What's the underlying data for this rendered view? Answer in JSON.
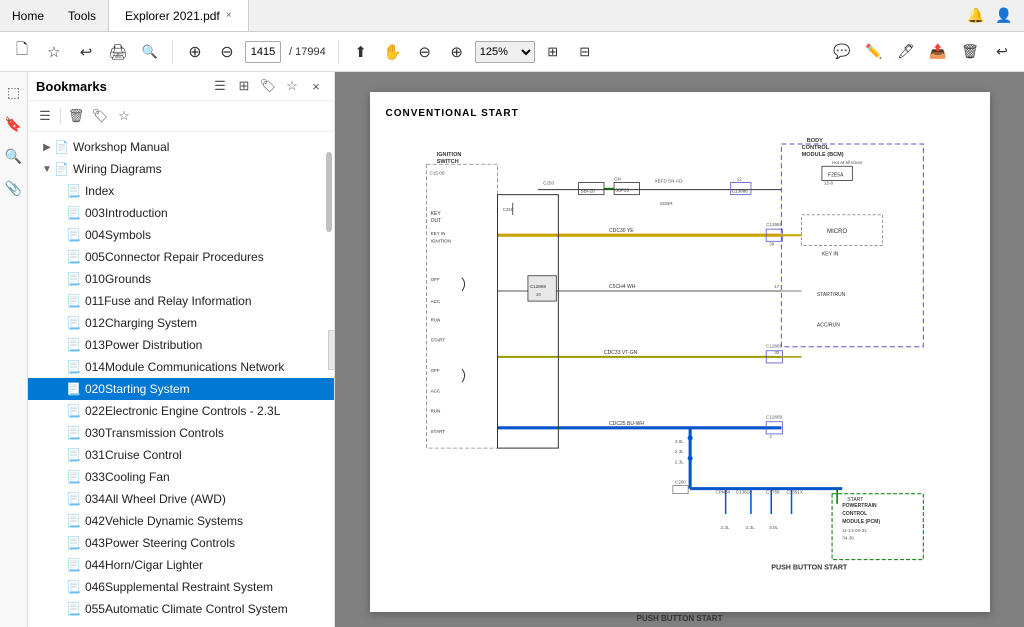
{
  "titlebar": {
    "home_label": "Home",
    "tools_label": "Tools",
    "file_tab": "Explorer 2021.pdf",
    "close_icon": "×",
    "right_icons": [
      "🔔",
      "👤"
    ]
  },
  "toolbar": {
    "page_current": "1415",
    "page_total": "17994",
    "zoom_level": "125%",
    "icons": {
      "new": "🗋",
      "bookmark": "☆",
      "back": "↩",
      "print": "🖨",
      "zoom_out_small": "🔍"
    }
  },
  "bookmarks": {
    "panel_title": "Bookmarks",
    "close": "×",
    "items": [
      {
        "id": "workshop",
        "label": "Workshop Manual",
        "level": 0,
        "expandable": true,
        "icon": "doc"
      },
      {
        "id": "wiring",
        "label": "Wiring Diagrams",
        "level": 0,
        "expandable": true,
        "expanded": true,
        "icon": "doc"
      },
      {
        "id": "index",
        "label": "Index",
        "level": 1,
        "expandable": false,
        "icon": "page"
      },
      {
        "id": "003intro",
        "label": "003Introduction",
        "level": 1,
        "expandable": false,
        "icon": "page"
      },
      {
        "id": "004symbols",
        "label": "004Symbols",
        "level": 1,
        "expandable": false,
        "icon": "page"
      },
      {
        "id": "005connector",
        "label": "005Connector Repair Procedures",
        "level": 1,
        "expandable": false,
        "icon": "page"
      },
      {
        "id": "010grounds",
        "label": "010Grounds",
        "level": 1,
        "expandable": false,
        "icon": "page"
      },
      {
        "id": "011fuse",
        "label": "011Fuse and Relay Information",
        "level": 1,
        "expandable": false,
        "icon": "page"
      },
      {
        "id": "012charging",
        "label": "012Charging System",
        "level": 1,
        "expandable": false,
        "icon": "page"
      },
      {
        "id": "013power",
        "label": "013Power Distribution",
        "level": 1,
        "expandable": false,
        "icon": "page"
      },
      {
        "id": "014module",
        "label": "014Module Communications Network",
        "level": 1,
        "expandable": false,
        "icon": "page"
      },
      {
        "id": "020starting",
        "label": "020Starting System",
        "level": 1,
        "expandable": false,
        "icon": "page",
        "selected": true
      },
      {
        "id": "022electronic",
        "label": "022Electronic Engine Controls - 2.3L",
        "level": 1,
        "expandable": false,
        "icon": "page"
      },
      {
        "id": "030transmission",
        "label": "030Transmission Controls",
        "level": 1,
        "expandable": false,
        "icon": "page"
      },
      {
        "id": "031cruise",
        "label": "031Cruise Control",
        "level": 1,
        "expandable": false,
        "icon": "page"
      },
      {
        "id": "033cooling",
        "label": "033Cooling Fan",
        "level": 1,
        "expandable": false,
        "icon": "page"
      },
      {
        "id": "034awd",
        "label": "034All Wheel Drive (AWD)",
        "level": 1,
        "expandable": false,
        "icon": "page"
      },
      {
        "id": "042vehicle",
        "label": "042Vehicle Dynamic Systems",
        "level": 1,
        "expandable": false,
        "icon": "page"
      },
      {
        "id": "043power",
        "label": "043Power Steering Controls",
        "level": 1,
        "expandable": false,
        "icon": "page"
      },
      {
        "id": "044horn",
        "label": "044Horn/Cigar Lighter",
        "level": 1,
        "expandable": false,
        "icon": "page"
      },
      {
        "id": "046supplemental",
        "label": "046Supplemental Restraint System",
        "level": 1,
        "expandable": false,
        "icon": "page"
      },
      {
        "id": "055climate",
        "label": "055Automatic Climate Control System",
        "level": 1,
        "expandable": false,
        "icon": "page"
      }
    ]
  },
  "diagram": {
    "title": "CONVENTIONAL START",
    "page_label": "PUSH BUTTON START"
  }
}
